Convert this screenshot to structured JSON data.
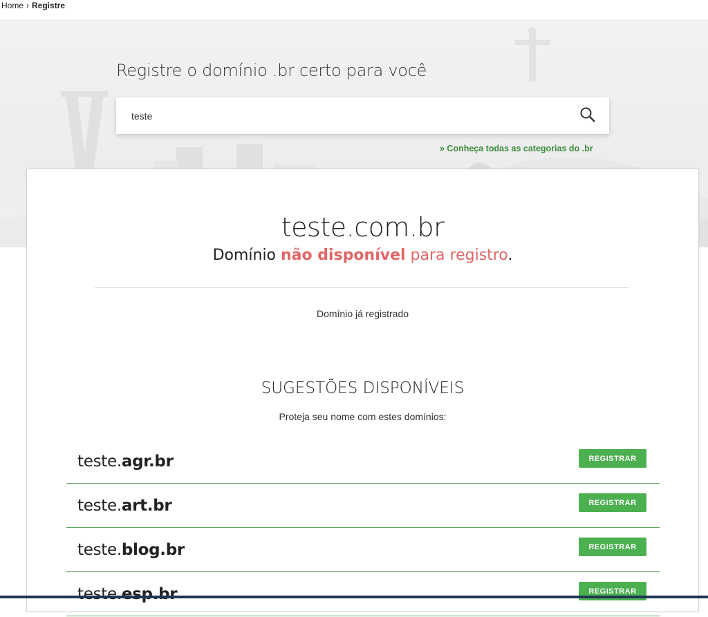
{
  "breadcrumb": {
    "home": "Home",
    "separator": "›",
    "current": "Registre"
  },
  "hero": {
    "title": "Registre o domínio .br certo para você",
    "search_value": "teste",
    "categories_link": "» Conheça todas as categorias do .br"
  },
  "result": {
    "domain": "teste.com.br",
    "status_prefix": "Domínio ",
    "status_unavailable": "não disponível",
    "status_suffix": " para registro",
    "status_period": ".",
    "note": "Domínio já registrado"
  },
  "suggestions": {
    "title": "SUGESTÕES DISPONÍVEIS",
    "subtitle": "Proteja seu nome com estes domínios:",
    "items": [
      {
        "name": "teste.",
        "ext": "agr.br",
        "button": "REGISTRAR"
      },
      {
        "name": "teste.",
        "ext": "art.br",
        "button": "REGISTRAR"
      },
      {
        "name": "teste.",
        "ext": "blog.br",
        "button": "REGISTRAR"
      },
      {
        "name": "teste.",
        "ext": "esp.br",
        "button": "REGISTRAR"
      }
    ]
  },
  "colors": {
    "accent_green": "#4caf50",
    "link_green": "#3d8b3d",
    "unavailable_red": "#e06666"
  },
  "icons": {
    "search": "search-icon"
  }
}
